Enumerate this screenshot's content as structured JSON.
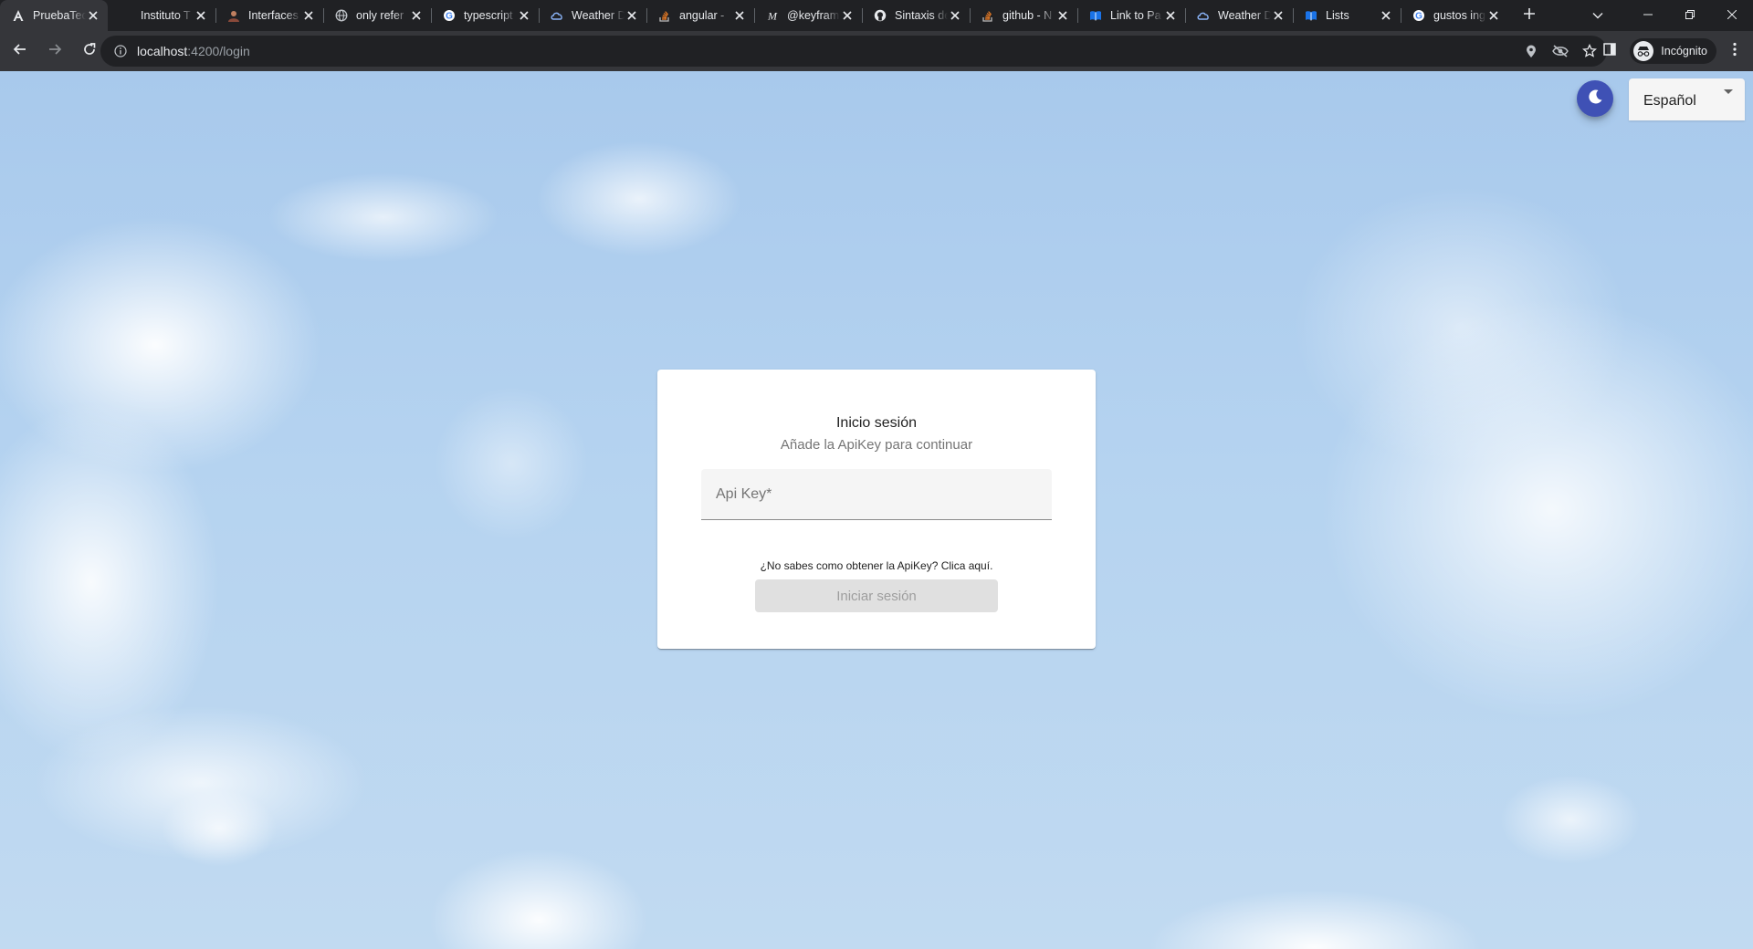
{
  "browser": {
    "tabs": [
      {
        "title": "PruebaTec",
        "icon": "angular-a-icon",
        "active": true
      },
      {
        "title": "Instituto T",
        "icon": "blank-favicon"
      },
      {
        "title": "Interfaces",
        "icon": "avatar-favicon"
      },
      {
        "title": "only refer",
        "icon": "globe-icon"
      },
      {
        "title": "typescript",
        "icon": "google-icon"
      },
      {
        "title": "Weather D",
        "icon": "weather-cloud-icon"
      },
      {
        "title": "angular -",
        "icon": "stackoverflow-icon"
      },
      {
        "title": "@keyfram",
        "icon": "medium-icon"
      },
      {
        "title": "Sintaxis de",
        "icon": "github-icon"
      },
      {
        "title": "github - N",
        "icon": "stackoverflow-icon"
      },
      {
        "title": "Link to Pa",
        "icon": "book-icon"
      },
      {
        "title": "Weather D",
        "icon": "weather-cloud-icon"
      },
      {
        "title": "Lists",
        "icon": "book-icon"
      },
      {
        "title": "gustos ing",
        "icon": "google-icon"
      }
    ],
    "url": {
      "host": "localhost",
      "path": ":4200/login"
    },
    "profile_label": "Incógnito"
  },
  "page": {
    "language": {
      "selected": "Español"
    },
    "login": {
      "title": "Inicio sesión",
      "subtitle": "Añade la ApiKey para continuar",
      "apikey_placeholder": "Api Key*",
      "help_text": "¿No sabes como obtener la ApiKey? Clica aquí.",
      "submit_label": "Iniciar sesión"
    }
  },
  "colors": {
    "theme_button": "#3f51b5",
    "button_disabled_bg": "#e0e0e0",
    "sky": "#b5d3f0"
  }
}
